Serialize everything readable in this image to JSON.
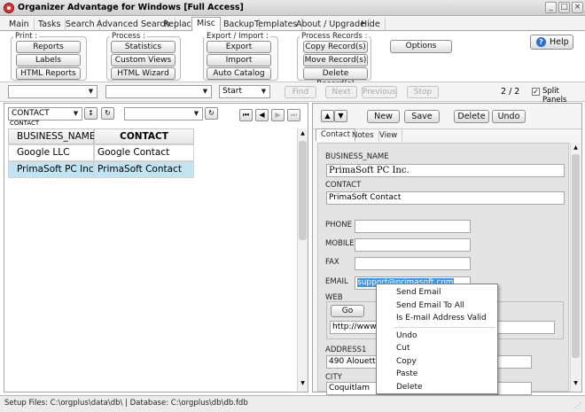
{
  "window": {
    "title": "Organizer Advantage for Windows [Full Access]",
    "controls": [
      "_",
      "□",
      "×"
    ]
  },
  "tabs": [
    "Main",
    "Tasks",
    "Search",
    "Advanced Search",
    "Replace",
    "Misc",
    "Backup",
    "Templates",
    "About / Upgrade",
    "Hide"
  ],
  "active_tab": "Misc",
  "ribbon": {
    "print": {
      "title": "Print :",
      "buttons": [
        "Reports",
        "Labels",
        "HTML Reports"
      ]
    },
    "process": {
      "title": "Process :",
      "buttons": [
        "Statistics",
        "Custom Views",
        "HTML Wizard"
      ]
    },
    "export_import": {
      "title": "Export / Import :",
      "buttons": [
        "Export",
        "Import",
        "Auto Catalog"
      ]
    },
    "process_records": {
      "title": "Process Records :",
      "buttons": [
        "Copy Record(s)",
        "Move Record(s)",
        "Delete Record(s)"
      ]
    },
    "options_label": "Options",
    "help_label": "Help"
  },
  "search_toolbar": {
    "start_value": "Start",
    "find_label": "Find",
    "next_label": "Next",
    "previous_label": "Previous",
    "stop_label": "Stop",
    "record_count": "2 / 2",
    "split_panels_label": "Split Panels"
  },
  "left_toolbar": {
    "sort_field": "CONTACT",
    "sort_caption": "CONTACT"
  },
  "grid": {
    "columns": [
      "BUSINESS_NAME",
      "CONTACT"
    ],
    "rows": [
      [
        "Google LLC",
        "Google Contact"
      ],
      [
        "PrimaSoft PC Inc.",
        "PrimaSoft Contact"
      ]
    ],
    "current_row_marker": "I"
  },
  "right_toolbar": {
    "new_label": "New",
    "save_label": "Save",
    "delete_label": "Delete",
    "undo_label": "Undo"
  },
  "form_tabs": [
    "Contact",
    "Notes",
    "View"
  ],
  "form": {
    "business_name_label": "BUSINESS_NAME",
    "business_name_value": "PrimaSoft PC Inc.",
    "contact_label": "CONTACT",
    "contact_value": "PrimaSoft Contact",
    "phone_label": "PHONE",
    "mobile_label": "MOBILE",
    "fax_label": "FAX",
    "email_label": "EMAIL",
    "email_value": "support@primasoft.com",
    "web_label": "WEB",
    "go_label": "Go",
    "web_value": "http://www.p",
    "address1_label": "ADDRESS1",
    "address1_value": "490 Alouette D",
    "city_label": "CITY",
    "city_value": "Coquitlam"
  },
  "context_menu": [
    "Send Email",
    "Send Email To All",
    "Is E-mail Address Valid",
    "Undo",
    "Cut",
    "Copy",
    "Paste",
    "Delete"
  ],
  "status_bar": "Setup Files: C:\\orgplus\\data\\db\\ | Database: C:\\orgplus\\db\\db.fdb",
  "colors": {
    "selected_row": "#bfe4f4",
    "email_highlight": "#3399ff",
    "app_icon": "#d33333"
  }
}
